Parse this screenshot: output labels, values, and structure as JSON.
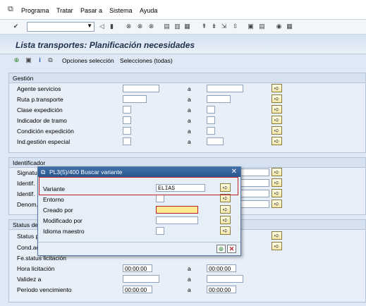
{
  "menubar": {
    "items": [
      {
        "label": "Programa"
      },
      {
        "label": "Tratar"
      },
      {
        "label": "Pasar a"
      },
      {
        "label": "Sistema"
      },
      {
        "label": "Ayuda"
      }
    ]
  },
  "toolbar": {
    "command_value": ""
  },
  "page": {
    "title": "Lista transportes: Planificación necesidades"
  },
  "app_toolbar": {
    "opciones_label": "Opciones selección",
    "selecciones_label": "Selecciones (todas)"
  },
  "gestion": {
    "title": "Gestión",
    "range_sep": "a",
    "rows": [
      {
        "label": "Agente servicios"
      },
      {
        "label": "Ruta p.transporte"
      },
      {
        "label": "Clase expedición"
      },
      {
        "label": "Indicador de tramo"
      },
      {
        "label": "Condición expedición"
      },
      {
        "label": "Ind.gestión especial"
      }
    ]
  },
  "identificador": {
    "title": "Identificador",
    "range_sep": "a",
    "rows": [
      {
        "label": "Signatura"
      },
      {
        "label": "Identif."
      },
      {
        "label": "Identif."
      },
      {
        "label": "Denom."
      }
    ]
  },
  "status": {
    "title": "Status de",
    "range_sep": "a",
    "rows": [
      {
        "label": "Status p",
        "value": ""
      },
      {
        "label": "Cond.ac",
        "value": ""
      },
      {
        "label": "Fe.status licitación",
        "value": ""
      },
      {
        "label": "Hora licitación",
        "value": "00:00:00",
        "value_to": "00:00:00"
      },
      {
        "label": "Validez a",
        "value": ""
      },
      {
        "label": "Período vencimiento",
        "value": "00:00:00",
        "value_to": "00:00:00"
      }
    ]
  },
  "dialog": {
    "title": "PL3(5)/400 Buscar variante",
    "fields": [
      {
        "label": "Variante",
        "value": "ELIAS"
      },
      {
        "label": "Entorno",
        "value": ""
      },
      {
        "label": "Creado por",
        "value": ""
      },
      {
        "label": "Modificado por",
        "value": ""
      },
      {
        "label": "Idioma maestro",
        "value": ""
      }
    ]
  },
  "colors": {
    "accent": "#2c5690",
    "highlight_field": "#fde98f",
    "red_outline": "#c0202a"
  }
}
